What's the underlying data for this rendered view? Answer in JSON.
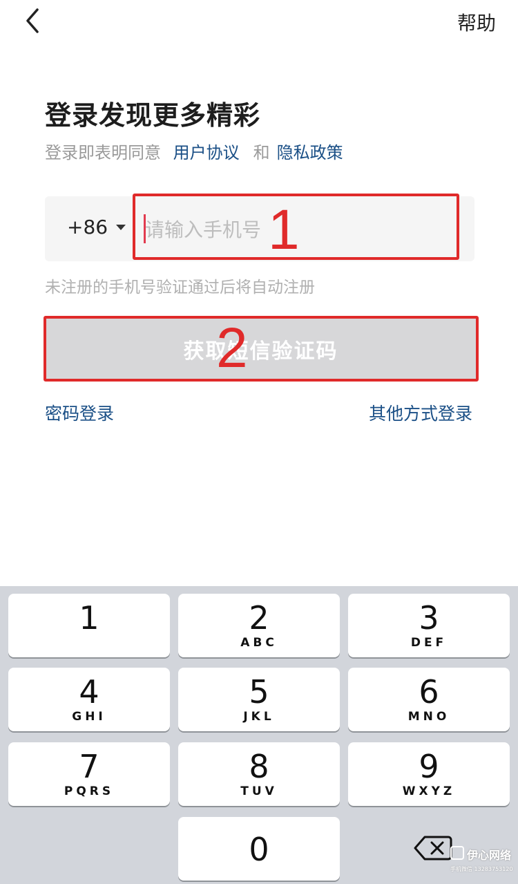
{
  "header": {
    "help_label": "帮助"
  },
  "login": {
    "title": "登录发现更多精彩",
    "agreement_prefix": "登录即表明同意",
    "user_agreement": "用户协议",
    "and": "和",
    "privacy_policy": "隐私政策",
    "country_code": "+86",
    "phone_placeholder": "请输入手机号",
    "phone_value": "",
    "hint": "未注册的手机号验证通过后将自动注册",
    "sms_button": "获取短信验证码",
    "password_login": "密码登录",
    "other_login": "其他方式登录"
  },
  "annotations": [
    "1",
    "2"
  ],
  "keyboard": {
    "keys": [
      {
        "digit": "1",
        "letters": ""
      },
      {
        "digit": "2",
        "letters": "ABC"
      },
      {
        "digit": "3",
        "letters": "DEF"
      },
      {
        "digit": "4",
        "letters": "GHI"
      },
      {
        "digit": "5",
        "letters": "JKL"
      },
      {
        "digit": "6",
        "letters": "MNO"
      },
      {
        "digit": "7",
        "letters": "PQRS"
      },
      {
        "digit": "8",
        "letters": "TUV"
      },
      {
        "digit": "9",
        "letters": "WXYZ"
      },
      {
        "digit": "0",
        "letters": ""
      }
    ]
  },
  "watermark": {
    "title": "伊心网络",
    "subtitle": "手机微信 13283753120"
  },
  "colors": {
    "link": "#1a4f86",
    "annotation": "#e02a2a",
    "button_disabled": "#d7d7d9",
    "keyboard_bg": "#d2d5db"
  }
}
